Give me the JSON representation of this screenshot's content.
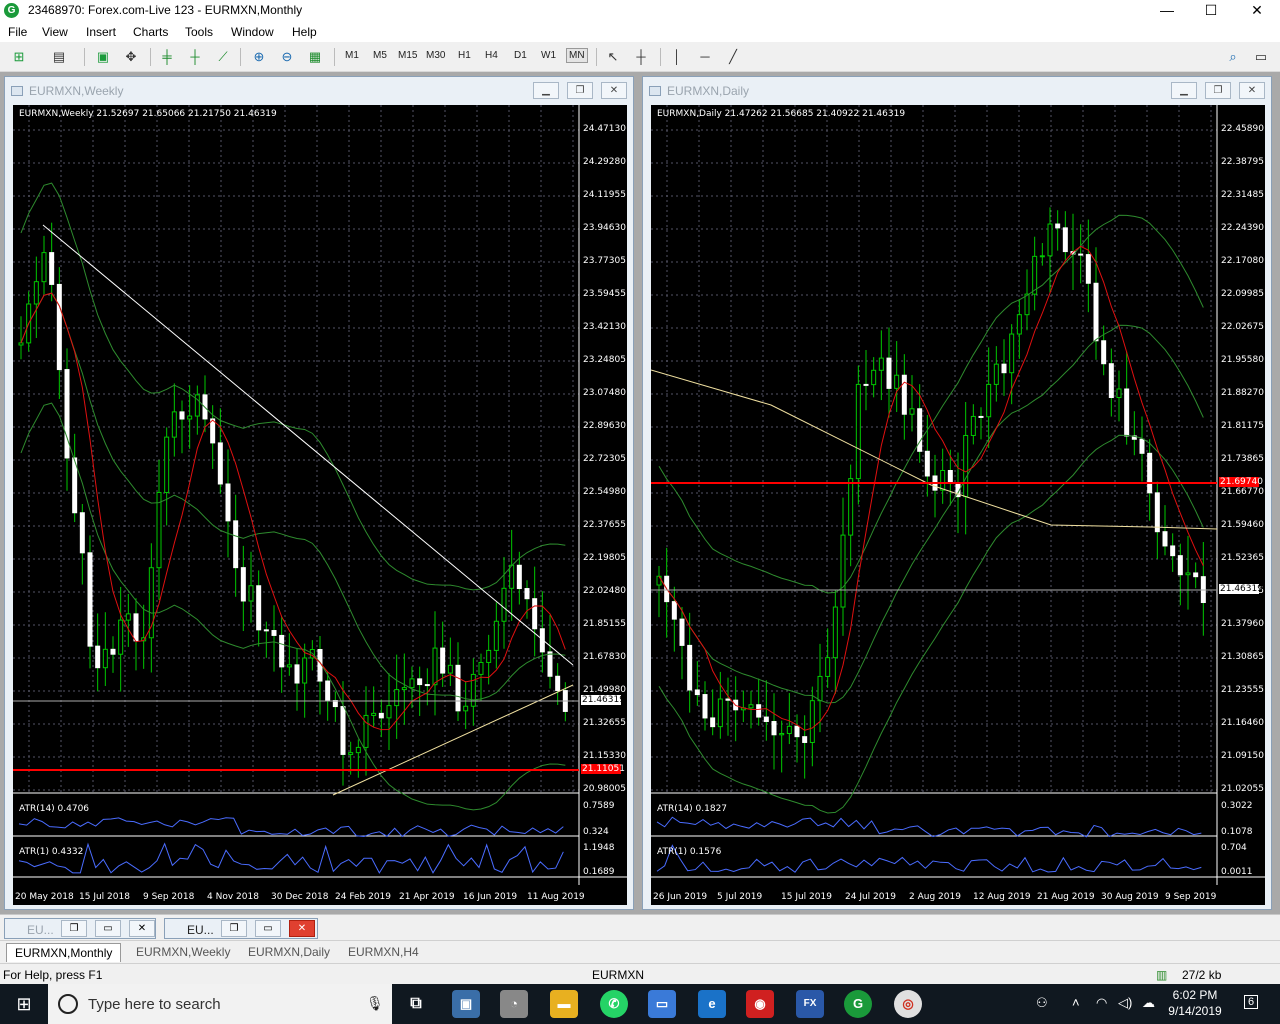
{
  "window": {
    "title": "23468970: Forex.com-Live 123 - EURMXN,Monthly",
    "controls": [
      "—",
      "☐",
      "✕"
    ]
  },
  "menu": [
    "File",
    "View",
    "Insert",
    "Charts",
    "Tools",
    "Window",
    "Help"
  ],
  "toolbar": {
    "timeframes": [
      "M1",
      "M5",
      "M15",
      "M30",
      "H1",
      "H4",
      "D1",
      "W1",
      "MN"
    ],
    "selected": "MN"
  },
  "charts": [
    {
      "window_title": "EURMXN,Weekly",
      "info": "EURMXN,Weekly  21.52697 21.65066 21.21750 21.46319",
      "price_labels": [
        "24.47130",
        "24.29280",
        "24.11955",
        "23.94630",
        "23.77305",
        "23.59455",
        "23.42130",
        "23.24805",
        "23.07480",
        "22.89630",
        "22.72305",
        "22.54980",
        "22.37655",
        "22.19805",
        "22.02480",
        "21.85155",
        "21.67830",
        "21.49980",
        "21.32655",
        "21.15330",
        "20.98005"
      ],
      "current_price": "21.46319",
      "red_line_price": "21.11051",
      "atr14_label": "ATR(14) 0.4706",
      "atr14_scale": [
        "0.7589",
        "0.324"
      ],
      "atr1_label": "ATR(1) 0.4332",
      "atr1_scale": [
        "1.1948",
        "0.1689"
      ],
      "dates": [
        "20 May 2018",
        "15 Jul 2018",
        "9 Sep 2018",
        "4 Nov 2018",
        "30 Dec 2018",
        "24 Feb 2019",
        "21 Apr 2019",
        "16 Jun 2019",
        "11 Aug 2019"
      ]
    },
    {
      "window_title": "EURMXN,Daily",
      "info": "EURMXN,Daily  21.47262 21.56685 21.40922 21.46319",
      "price_labels": [
        "22.45890",
        "22.38795",
        "22.31485",
        "22.24390",
        "22.17080",
        "22.09985",
        "22.02675",
        "21.95580",
        "21.88270",
        "21.81175",
        "21.73865",
        "21.66770",
        "21.59460",
        "21.52365",
        "21.45055",
        "21.37960",
        "21.30865",
        "21.23555",
        "21.16460",
        "21.09150",
        "21.02055"
      ],
      "current_price": "21.46319",
      "red_line_price": "21.69740",
      "atr14_label": "ATR(14) 0.1827",
      "atr14_scale": [
        "0.3022",
        "0.1078"
      ],
      "atr1_label": "ATR(1) 0.1576",
      "atr1_scale": [
        "0.704",
        "0.0011"
      ],
      "dates": [
        "26 Jun 2019",
        "5 Jul 2019",
        "15 Jul 2019",
        "24 Jul 2019",
        "2 Aug 2019",
        "12 Aug 2019",
        "21 Aug 2019",
        "30 Aug 2019",
        "9 Sep 2019"
      ]
    }
  ],
  "minimized": [
    {
      "name": "EU..."
    },
    {
      "name": "EU..."
    }
  ],
  "tabs": [
    "EURMXN,Monthly",
    "EURMXN,Weekly",
    "EURMXN,Daily",
    "EURMXN,H4"
  ],
  "active_tab": "EURMXN,Monthly",
  "status": {
    "help": "For Help, press F1",
    "symbol": "EURMXN",
    "traffic": "27/2 kb"
  },
  "taskbar": {
    "search_placeholder": "Type here to search",
    "time": "6:02 PM",
    "date": "9/14/2019",
    "notifications": "6"
  },
  "colors": {
    "bull": "#00c800",
    "bear": "#00c800",
    "ma_red": "#e01010",
    "ma_yellow": "#f0e0a0",
    "band": "#2e8b2e",
    "atr": "#4a6cff",
    "level_red": "#ff0000"
  }
}
